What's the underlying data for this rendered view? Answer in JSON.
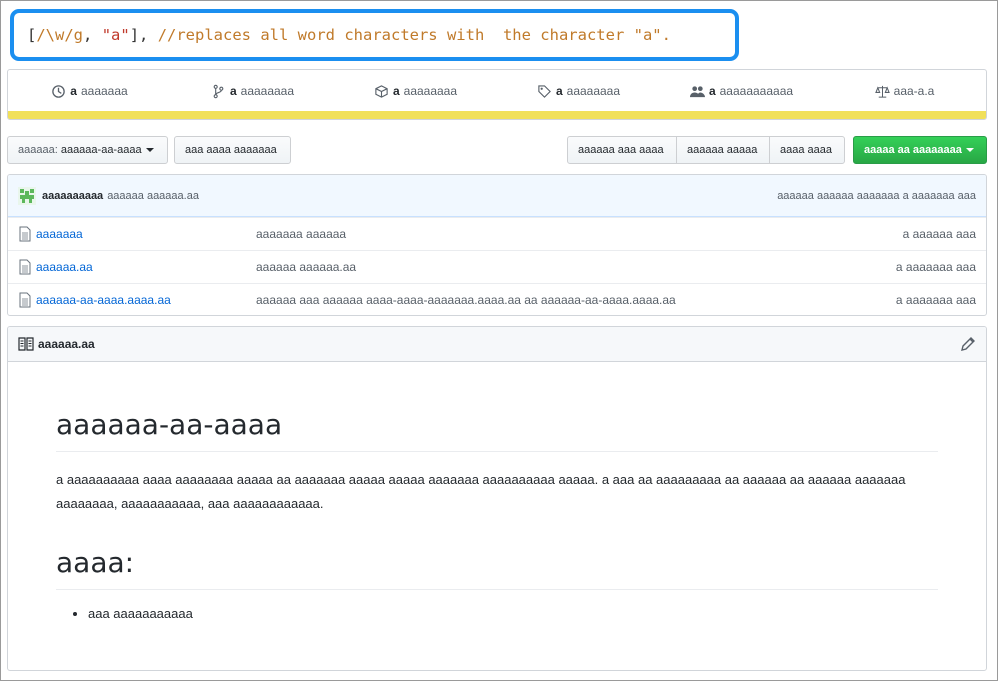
{
  "callout": {
    "open_bracket": "[",
    "regex": "/\\w/g",
    "comma1": ", ",
    "string": "\"a\"",
    "close": "], ",
    "comment": "//replaces all word characters with  the character \"a\".",
    "border_color": "#1b8ff0"
  },
  "stats": [
    {
      "icon": "history-icon",
      "count": "a",
      "label": "aaaaaaa"
    },
    {
      "icon": "branch-icon",
      "count": "a",
      "label": "aaaaaaaa"
    },
    {
      "icon": "package-icon",
      "count": "a",
      "label": "aaaaaaaa"
    },
    {
      "icon": "tag-icon",
      "count": "a",
      "label": "aaaaaaaa"
    },
    {
      "icon": "people-icon",
      "count": "a",
      "label": "aaaaaaaaaaa"
    },
    {
      "icon": "law-icon",
      "count": "",
      "label": "aaa-a.a"
    }
  ],
  "language_color": "#f1e05a",
  "toolbar": {
    "branch_prefix": "aaaaaa:",
    "branch_name": "aaaaaa-aa-aaaa",
    "new_pr": "aaa aaaa aaaaaaa",
    "create_file": "aaaaaa aaa aaaa",
    "upload_files": "aaaaaa aaaaa",
    "find_file": "aaaa aaaa",
    "clone": "aaaaa aa aaaaaaaa",
    "clone_color": "#28a745"
  },
  "commit": {
    "author": "aaaaaaaaaa",
    "message": "aaaaaa aaaaaa.aa",
    "right": "aaaaaa aaaaaa aaaaaaa a aaaaaaa aaa"
  },
  "files": [
    {
      "name": "aaaaaaa",
      "message": "aaaaaaa aaaaaa",
      "age": "a aaaaaa aaa"
    },
    {
      "name": "aaaaaa.aa",
      "message": "aaaaaa aaaaaa.aa",
      "age": "a aaaaaaa aaa"
    },
    {
      "name": "aaaaaa-aa-aaaa.aaaa.aa",
      "message": "aaaaaa aaa aaaaaa aaaa-aaaa-aaaaaaa.aaaa.aa aa aaaaaa-aa-aaaa.aaaa.aa",
      "age": "a aaaaaaa aaa"
    }
  ],
  "readme": {
    "filename": "aaaaaa.aa",
    "title": "aaaaaa-aa-aaaa",
    "paragraph": "a aaaaaaaaaa aaaa aaaaaaaa aaaaa aa aaaaaaa aaaaa aaaaa aaaaaaa aaaaaaaaaa aaaaa. a aaa aa aaaaaaaaa aa aaaaaa aa aaaaaa aaaaaaa aaaaaaaa, aaaaaaaaaaa, aaa aaaaaaaaaaaa.",
    "section": "aaaa:",
    "items": [
      "aaa aaaaaaaaaaa"
    ]
  }
}
